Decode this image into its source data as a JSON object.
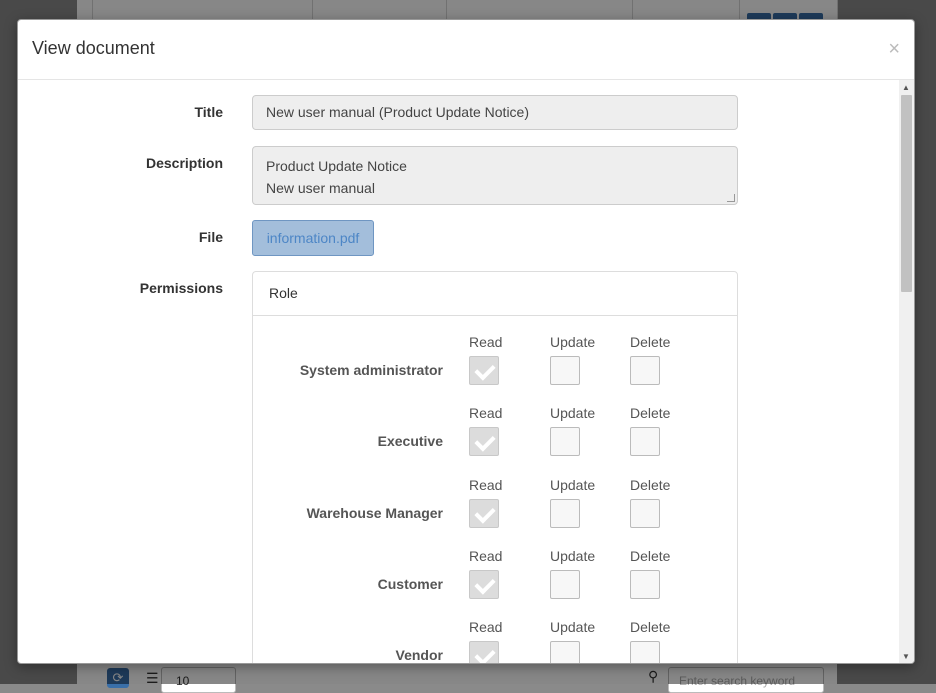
{
  "modal": {
    "title": "View document",
    "close": "×"
  },
  "form": {
    "title_label": "Title",
    "title_value": "New user manual (Product Update Notice)",
    "description_label": "Description",
    "description_lines": [
      "Product Update Notice",
      "New user manual"
    ],
    "file_label": "File",
    "file_name": "information.pdf",
    "permissions_label": "Permissions"
  },
  "permissions": {
    "heading": "Role",
    "columns": [
      "Read",
      "Update",
      "Delete"
    ],
    "roles": [
      {
        "name": "System administrator",
        "read": true,
        "update": false,
        "delete": false
      },
      {
        "name": "Executive",
        "read": true,
        "update": false,
        "delete": false
      },
      {
        "name": "Warehouse Manager",
        "read": true,
        "update": false,
        "delete": false
      },
      {
        "name": "Customer",
        "read": true,
        "update": false,
        "delete": false
      },
      {
        "name": "Vendor",
        "read": true,
        "update": false,
        "delete": false
      }
    ]
  },
  "background": {
    "page_size": "10",
    "search_placeholder": "Enter search keyword"
  }
}
